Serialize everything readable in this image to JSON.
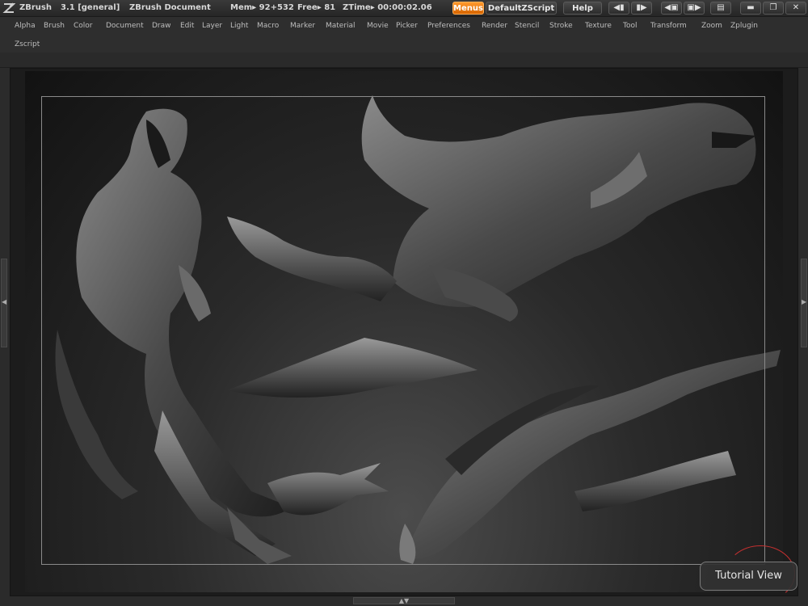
{
  "titlebar": {
    "app_name": "ZBrush",
    "version": "3.1 [general]",
    "document": "ZBrush Document",
    "mem": "Mem▸ 92+532",
    "free": "Free▸ 81",
    "ztime": "ZTime▸ 00:00:02.06",
    "menus_label": "Menus",
    "script_label": "DefaultZScript",
    "help_label": "Help"
  },
  "menu": {
    "items": [
      "Alpha",
      "Brush",
      "Color",
      "Document",
      "Draw",
      "Edit",
      "Layer",
      "Light",
      "Macro",
      "Marker",
      "Material",
      "Movie",
      "Picker",
      "Preferences",
      "Render",
      "Stencil",
      "Stroke",
      "Texture",
      "Tool",
      "Transform",
      "Zoom",
      "Zplugin"
    ],
    "second_row": "Zscript"
  },
  "tutorial": {
    "label": "Tutorial View"
  },
  "icons": {
    "logo": "zbrush-logo-icon",
    "close": "close-icon",
    "restore": "restore-icon",
    "minimize": "minimize-icon"
  }
}
